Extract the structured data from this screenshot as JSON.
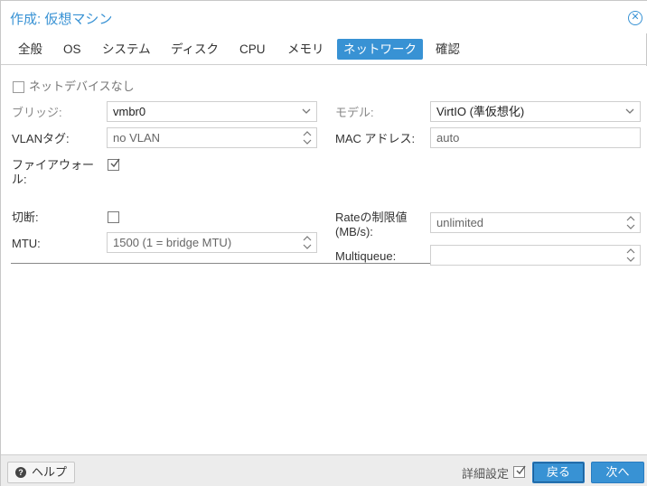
{
  "window": {
    "title": "作成: 仮想マシン"
  },
  "tabs": [
    {
      "label": "全般"
    },
    {
      "label": "OS"
    },
    {
      "label": "システム"
    },
    {
      "label": "ディスク"
    },
    {
      "label": "CPU"
    },
    {
      "label": "メモリ"
    },
    {
      "label": "ネットワーク",
      "active": true
    },
    {
      "label": "確認"
    }
  ],
  "form": {
    "no_network": {
      "label": "ネットデバイスなし",
      "checked": false
    },
    "bridge": {
      "label": "ブリッジ:",
      "value": "vmbr0"
    },
    "vlan": {
      "label": "VLANタグ:",
      "value": "no VLAN"
    },
    "firewall": {
      "label": "ファイアウォール:",
      "label_line1": "ファイアウォー",
      "label_line2": "ル:",
      "checked": true
    },
    "model": {
      "label": "モデル:",
      "value": "VirtIO (準仮想化)"
    },
    "mac": {
      "label": "MAC アドレス:",
      "value": "auto"
    },
    "disconnect": {
      "label": "切断:",
      "checked": false
    },
    "mtu": {
      "label": "MTU:",
      "value": "1500 (1 = bridge MTU)"
    },
    "rate": {
      "label_line1": "Rateの制限値",
      "label_line2": "(MB/s):",
      "value": "unlimited"
    },
    "multiqueue": {
      "label": "Multiqueue:",
      "value": ""
    }
  },
  "footer": {
    "help_label": "ヘルプ",
    "advanced_label": "詳細設定",
    "advanced_checked": true,
    "back_label": "戻る",
    "next_label": "次へ"
  },
  "colors": {
    "accent": "#3892d4",
    "footer_bg": "#ececec"
  }
}
